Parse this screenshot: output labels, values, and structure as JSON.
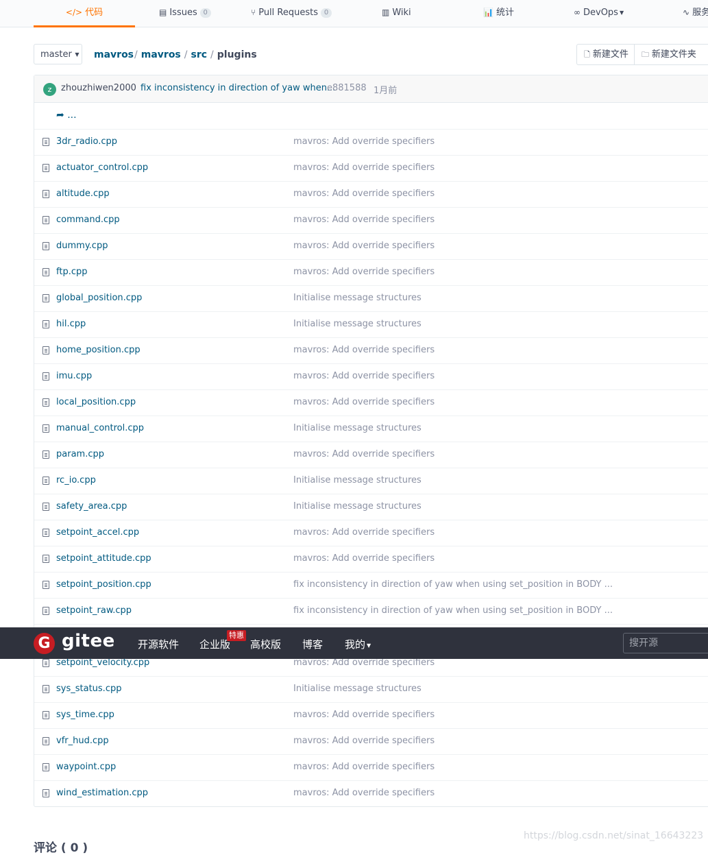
{
  "tabs": [
    {
      "icon": "</>",
      "label": "代码",
      "badge": null
    },
    {
      "icon": "▤",
      "label": "Issues",
      "badge": "0"
    },
    {
      "icon": "⑂",
      "label": "Pull Requests",
      "badge": "0"
    },
    {
      "icon": "▥",
      "label": "Wiki",
      "badge": null
    },
    {
      "icon": "📊",
      "label": "统计",
      "badge": null
    },
    {
      "icon": "∞",
      "label": "DevOps",
      "badge": null
    },
    {
      "icon": "∿",
      "label": "服务",
      "badge": null
    }
  ],
  "branch": {
    "label": "master"
  },
  "breadcrumb": [
    "mavros",
    "mavros",
    "src",
    "plugins"
  ],
  "new_buttons": {
    "new_file": "新建文件",
    "new_folder": "新建文件夹"
  },
  "commit": {
    "avatar_letter": "z",
    "author": "zhouzhiwen2000",
    "message": "fix inconsistency in direction of yaw when...",
    "sha": "e881588",
    "time": "1月前"
  },
  "parent_dir": "...",
  "files": [
    {
      "name": "3dr_radio.cpp",
      "commit": "mavros: Add override specifiers"
    },
    {
      "name": "actuator_control.cpp",
      "commit": "mavros: Add override specifiers"
    },
    {
      "name": "altitude.cpp",
      "commit": "mavros: Add override specifiers"
    },
    {
      "name": "command.cpp",
      "commit": "mavros: Add override specifiers"
    },
    {
      "name": "dummy.cpp",
      "commit": "mavros: Add override specifiers"
    },
    {
      "name": "ftp.cpp",
      "commit": "mavros: Add override specifiers"
    },
    {
      "name": "global_position.cpp",
      "commit": "Initialise message structures"
    },
    {
      "name": "hil.cpp",
      "commit": "Initialise message structures"
    },
    {
      "name": "home_position.cpp",
      "commit": "mavros: Add override specifiers"
    },
    {
      "name": "imu.cpp",
      "commit": "mavros: Add override specifiers"
    },
    {
      "name": "local_position.cpp",
      "commit": "mavros: Add override specifiers"
    },
    {
      "name": "manual_control.cpp",
      "commit": "Initialise message structures"
    },
    {
      "name": "param.cpp",
      "commit": "mavros: Add override specifiers"
    },
    {
      "name": "rc_io.cpp",
      "commit": "Initialise message structures"
    },
    {
      "name": "safety_area.cpp",
      "commit": "Initialise message structures"
    },
    {
      "name": "setpoint_accel.cpp",
      "commit": "mavros: Add override specifiers"
    },
    {
      "name": "setpoint_attitude.cpp",
      "commit": "mavros: Add override specifiers"
    },
    {
      "name": "setpoint_position.cpp",
      "commit": "fix inconsistency in direction of yaw when using set_position in BODY ..."
    },
    {
      "name": "setpoint_raw.cpp",
      "commit": "fix inconsistency in direction of yaw when using set_position in BODY ..."
    },
    {
      "name": "",
      "commit": ""
    },
    {
      "name": "setpoint_velocity.cpp",
      "commit": "mavros: Add override specifiers"
    },
    {
      "name": "sys_status.cpp",
      "commit": "Initialise message structures"
    },
    {
      "name": "sys_time.cpp",
      "commit": "mavros: Add override specifiers"
    },
    {
      "name": "vfr_hud.cpp",
      "commit": "mavros: Add override specifiers"
    },
    {
      "name": "waypoint.cpp",
      "commit": "mavros: Add override specifiers"
    },
    {
      "name": "wind_estimation.cpp",
      "commit": "mavros: Add override specifiers"
    }
  ],
  "gitee_header": {
    "logo_letter": "G",
    "brand": "gitee",
    "nav": [
      "开源软件",
      "企业版",
      "高校版",
      "博客",
      "我的"
    ],
    "hot_badge": "特惠",
    "search_placeholder": "搜开源"
  },
  "comments_title": "评论 ( 0 )",
  "watermark": "https://blog.csdn.net/sinat_16643223"
}
